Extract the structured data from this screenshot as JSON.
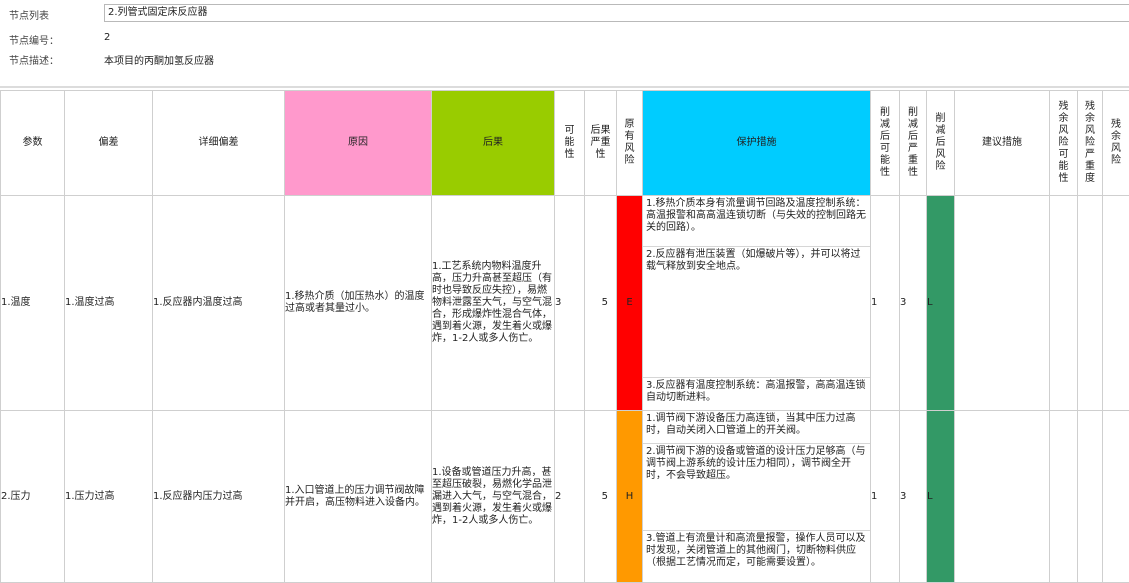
{
  "node": {
    "list_label": "节点列表",
    "list_value": "2.列管式固定床反应器",
    "id_label": "节点编号：",
    "id_value": "2",
    "desc_label": "节点描述：",
    "desc_value": "本项目的丙酮加氢反应器"
  },
  "columns": {
    "param": "参数",
    "deviation": "偏差",
    "detail": "详细偏差",
    "cause": "原因",
    "consequence": "后果",
    "likelihood": "可能性",
    "severity": "后果严重性",
    "risk": "原有风险",
    "protection": "保护措施",
    "red_likelihood": "削减后可能性",
    "red_severity": "削减后严重性",
    "red_risk": "削减后风险",
    "recommendation": "建议措施",
    "res_likelihood": "残余风险可能性",
    "res_severity": "残余风险严重度",
    "res_risk": "残余风险"
  },
  "colors": {
    "cause_header": "#ff99cc",
    "consequence_header": "#99cc00",
    "protection_header": "#00ccff",
    "risk_E": "#ff0000",
    "risk_H": "#ff9900",
    "risk_L": "#339966"
  },
  "rows": [
    {
      "param": "1.温度",
      "deviation": "1.温度过高",
      "detail": "1.反应器内温度过高",
      "cause": "1.移热介质（加压热水）的温度过高或者其量过小。",
      "consequence": "1.工艺系统内物料温度升高，压力升高甚至超压（有时也导致反应失控），易燃物料泄露至大气，与空气混合，形成爆炸性混合气体，遇到着火源，发生着火或爆炸，1-2人或多人伤亡。",
      "likelihood": "3",
      "severity": "5",
      "risk": "E",
      "protections": [
        "1.移热介质本身有流量调节回路及温度控制系统：高温报警和高高温连锁切断（与失效的控制回路无关的回路）。",
        "2.反应器有泄压装置（如爆破片等），并可以将过载气释放到安全地点。",
        "3.反应器有温度控制系统：高温报警，高高温连锁自动切断进料。"
      ],
      "red_likelihood": "1",
      "red_severity": "3",
      "red_risk": "L"
    },
    {
      "param": "2.压力",
      "deviation": "1.压力过高",
      "detail": "1.反应器内压力过高",
      "cause": "1.入口管道上的压力调节阀故障并开启，高压物料进入设备内。",
      "consequence": "1.设备或管道压力升高，甚至超压破裂，易燃化学品泄漏进入大气，与空气混合，遇到着火源，发生着火或爆炸，1-2人或多人伤亡。",
      "likelihood": "2",
      "severity": "5",
      "risk": "H",
      "protections": [
        "1.调节阀下游设备压力高连锁，当其中压力过高时，自动关闭入口管道上的开关阀。",
        "2.调节阀下游的设备或管道的设计压力足够高（与调节阀上游系统的设计压力相同），调节阀全开时，不会导致超压。",
        "3.管道上有流量计和高流量报警，操作人员可以及时发现，关闭管道上的其他阀门，切断物料供应（根据工艺情况而定，可能需要设置）。"
      ],
      "red_likelihood": "1",
      "red_severity": "3",
      "red_risk": "L"
    }
  ]
}
